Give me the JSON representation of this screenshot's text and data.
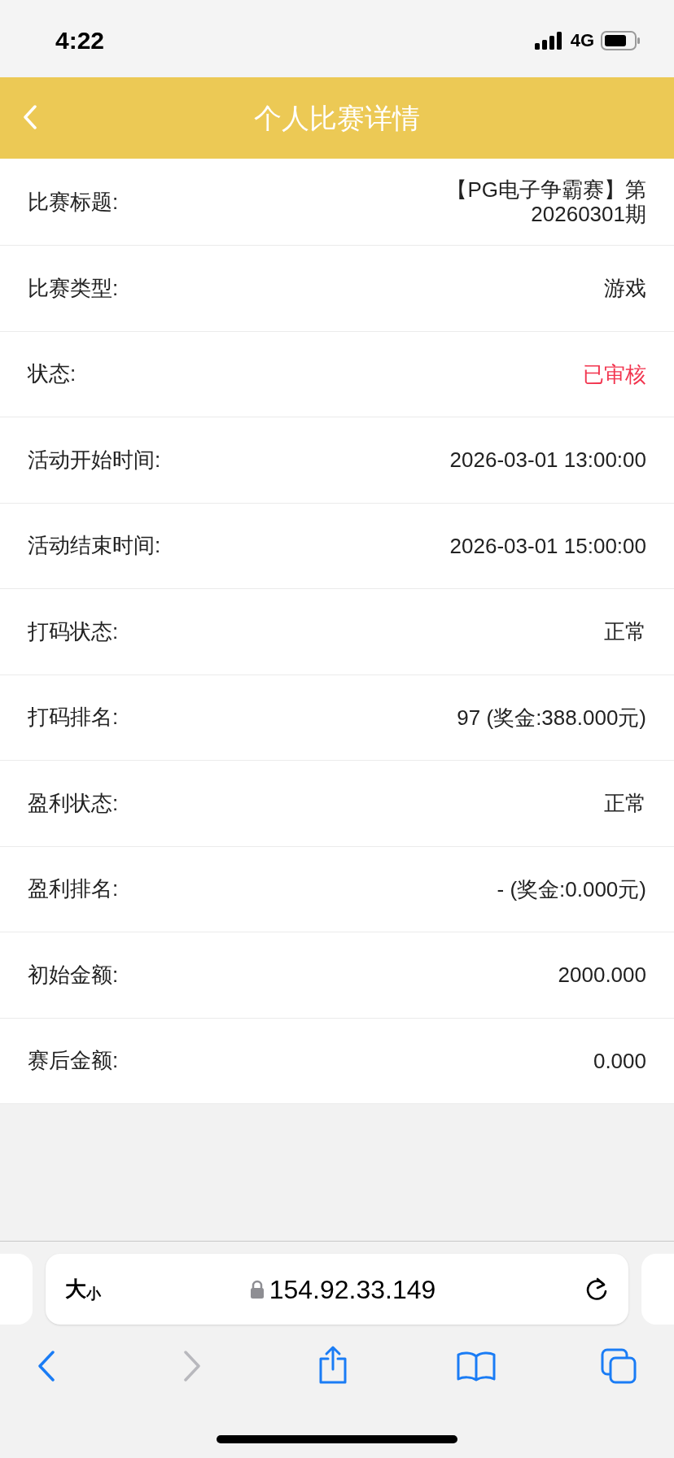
{
  "status_bar": {
    "time": "4:22",
    "network": "4G"
  },
  "header": {
    "title": "个人比赛详情"
  },
  "rows": [
    {
      "label": "比赛标题:",
      "value": "【PG电子争霸赛】第20260301期",
      "highlight": false
    },
    {
      "label": "比赛类型:",
      "value": "游戏",
      "highlight": false
    },
    {
      "label": "状态:",
      "value": "已审核",
      "highlight": true
    },
    {
      "label": "活动开始时间:",
      "value": "2026-03-01 13:00:00",
      "highlight": false
    },
    {
      "label": "活动结束时间:",
      "value": "2026-03-01 15:00:00",
      "highlight": false
    },
    {
      "label": "打码状态:",
      "value": "正常",
      "highlight": false
    },
    {
      "label": "打码排名:",
      "value": "97 (奖金:388.000元)",
      "highlight": false
    },
    {
      "label": "盈利状态:",
      "value": "正常",
      "highlight": false
    },
    {
      "label": "盈利排名:",
      "value": "- (奖金:0.000元)",
      "highlight": false
    },
    {
      "label": "初始金额:",
      "value": "2000.000",
      "highlight": false
    },
    {
      "label": "赛后金额:",
      "value": "0.000",
      "highlight": false
    }
  ],
  "browser": {
    "text_size_label": [
      "大",
      "小"
    ],
    "address": "154.92.33.149"
  }
}
